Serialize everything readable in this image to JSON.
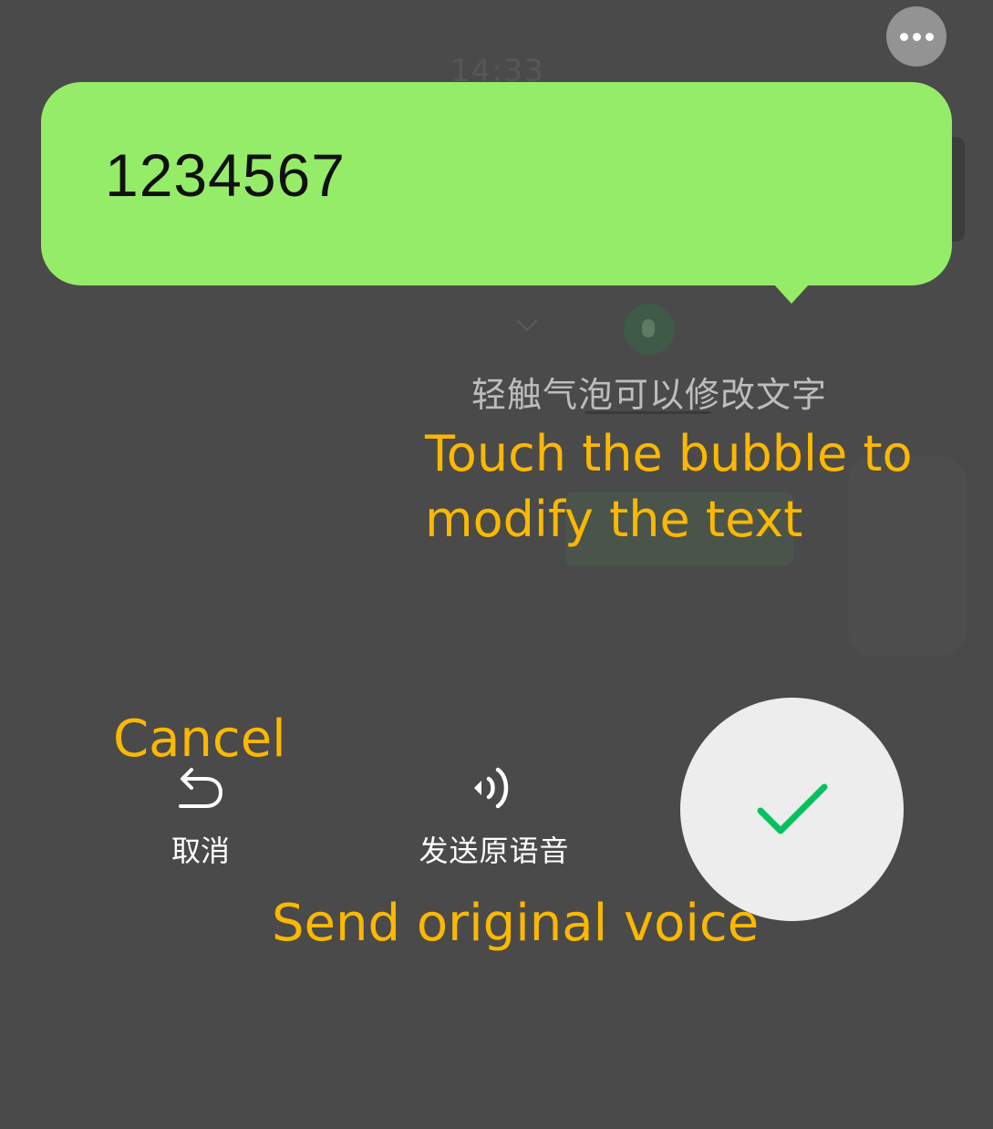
{
  "background": {
    "time": "14:33"
  },
  "toolbar": {
    "more_icon": "more-horizontal-icon"
  },
  "bubble": {
    "text": "1234567",
    "color": "#95ec69"
  },
  "hint": {
    "text": "轻触气泡可以修改文字"
  },
  "actions": {
    "cancel": {
      "label": "取消",
      "icon": "undo-arrow-icon"
    },
    "send_voice": {
      "label": "发送原语音",
      "icon": "voice-wave-icon"
    },
    "confirm": {
      "icon": "checkmark-icon",
      "color": "#07c160"
    }
  },
  "annotations": {
    "touch_line1": "Touch the bubble to",
    "touch_line2": "modify the text",
    "cancel": "Cancel",
    "send": "Send original voice",
    "color": "#fbb800"
  }
}
